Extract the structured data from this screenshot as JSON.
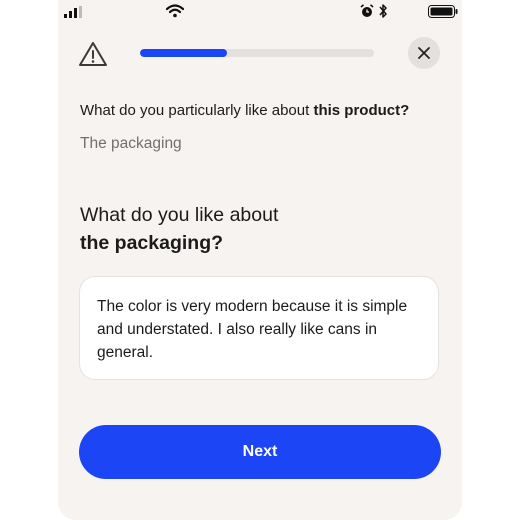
{
  "progress": {
    "value": 0.37
  },
  "colors": {
    "accent": "#1c45f5",
    "background": "#f7f3f0"
  },
  "icons": {
    "status": [
      "signal-icon",
      "wifi-icon",
      "alarm-icon",
      "bluetooth-icon",
      "battery-icon"
    ],
    "header": [
      "warning-icon",
      "close-icon"
    ]
  },
  "previous": {
    "question_prefix": "What do you particularly like about ",
    "question_bold": "this product?",
    "answer": "The packaging"
  },
  "question": {
    "line1": "What do you like about",
    "line2": "the packaging?"
  },
  "answer": {
    "text": "The color is very modern because it is simple and understated. I also really like cans in general."
  },
  "next_label": "Next"
}
